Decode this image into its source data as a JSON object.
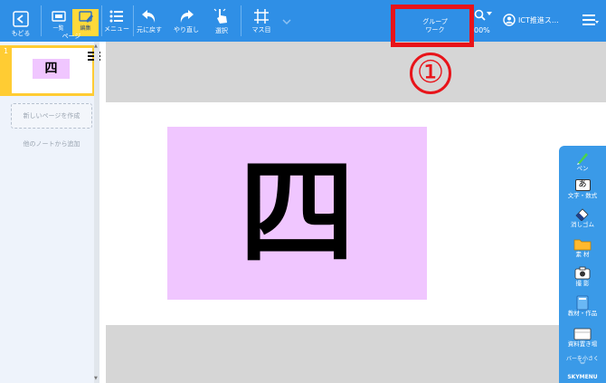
{
  "toolbar": {
    "back_label": "もどる",
    "page_list_label": "一覧",
    "page_edit_label": "編集",
    "page_caption": "ページ",
    "menu_label": "メニュー",
    "undo_label": "元に戻す",
    "redo_label": "やり直し",
    "select_label": "選択",
    "grid_label": "マス目",
    "group_work_line1": "グループ",
    "group_work_line2": "ワーク",
    "zoom_value": "00%",
    "user_name": "ICT推進ス…"
  },
  "annotation": {
    "marker": "①",
    "color": "#e8141a"
  },
  "sidebar": {
    "page_number": "1",
    "thumb_char": "四",
    "new_page": "新しいページを作成",
    "add_from_other": "他のノートから追加"
  },
  "canvas": {
    "card_char": "四",
    "card_color": "#f0c6ff"
  },
  "palette": {
    "items": [
      {
        "label": "ペン",
        "icon": "pen-icon"
      },
      {
        "label": "文字・数式",
        "icon": "text-icon",
        "glyph": "あ"
      },
      {
        "label": "消しゴム",
        "icon": "eraser-icon"
      },
      {
        "label": "素 材",
        "icon": "folder-icon"
      },
      {
        "label": "撮 影",
        "icon": "camera-icon"
      },
      {
        "label": "教材・作品",
        "icon": "book-icon"
      },
      {
        "label": "資料置き場",
        "icon": "storage-icon"
      }
    ],
    "shrink_label": "バーを小さく",
    "brand": "SKYMENU"
  },
  "colors": {
    "toolbar": "#2f8fe6",
    "active_tab": "#ffd93a",
    "palette": "#3a9ae8"
  }
}
